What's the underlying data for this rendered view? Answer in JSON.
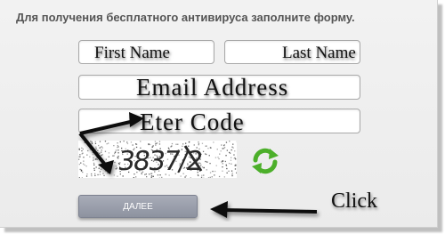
{
  "form": {
    "heading": "Для получения бесплатного антивируса заполните форму.",
    "first_name": "First Name",
    "last_name": "Last Name",
    "email": "Email Address",
    "code": "Eter Code",
    "captcha_text": "3837/2",
    "next_label": "ДАЛЕЕ"
  },
  "annotation": {
    "click_label": "Click"
  },
  "icons": {
    "refresh": "refresh-icon",
    "arrow": "arrow-annotation"
  },
  "colors": {
    "refresh_green": "#4caf2a",
    "button": "#9aa0ad"
  }
}
